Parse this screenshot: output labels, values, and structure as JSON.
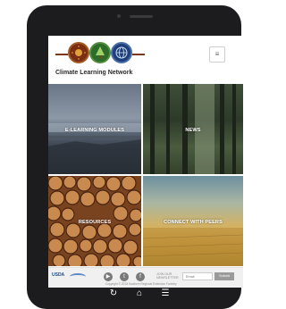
{
  "brand": {
    "name": "Climate Learning Network"
  },
  "header": {
    "menu_icon": "hamburger-menu-icon",
    "menu_glyph": "≡"
  },
  "tiles": [
    {
      "label": "E-LEARNING MODULES",
      "image": "foggy-lake-landscape"
    },
    {
      "label": "NEWS",
      "image": "misty-forest"
    },
    {
      "label": "RESOURCES",
      "image": "stacked-logs"
    },
    {
      "label": "CONNECT WITH PEERS",
      "image": "golden-wheat-field"
    }
  ],
  "footer": {
    "usda": "USDA",
    "social": [
      {
        "icon": "youtube-icon",
        "glyph": "▶"
      },
      {
        "icon": "twitter-icon",
        "glyph": "t"
      },
      {
        "icon": "facebook-icon",
        "glyph": "f"
      }
    ],
    "newsletter_label": "JOIN OUR NEWSLETTER",
    "email_placeholder": "Email",
    "submit_label": "Submit",
    "copyright": "Copyright © 2015 Southern Regional Extension Forestry"
  },
  "nav": [
    {
      "icon": "refresh-icon",
      "glyph": "↻"
    },
    {
      "icon": "home-icon",
      "glyph": "⌂"
    },
    {
      "icon": "list-icon",
      "glyph": "☰"
    }
  ],
  "colors": {
    "accent": "#7b2e14",
    "tree_green": "#2d6b2a",
    "globe_blue": "#1f3f7a"
  }
}
